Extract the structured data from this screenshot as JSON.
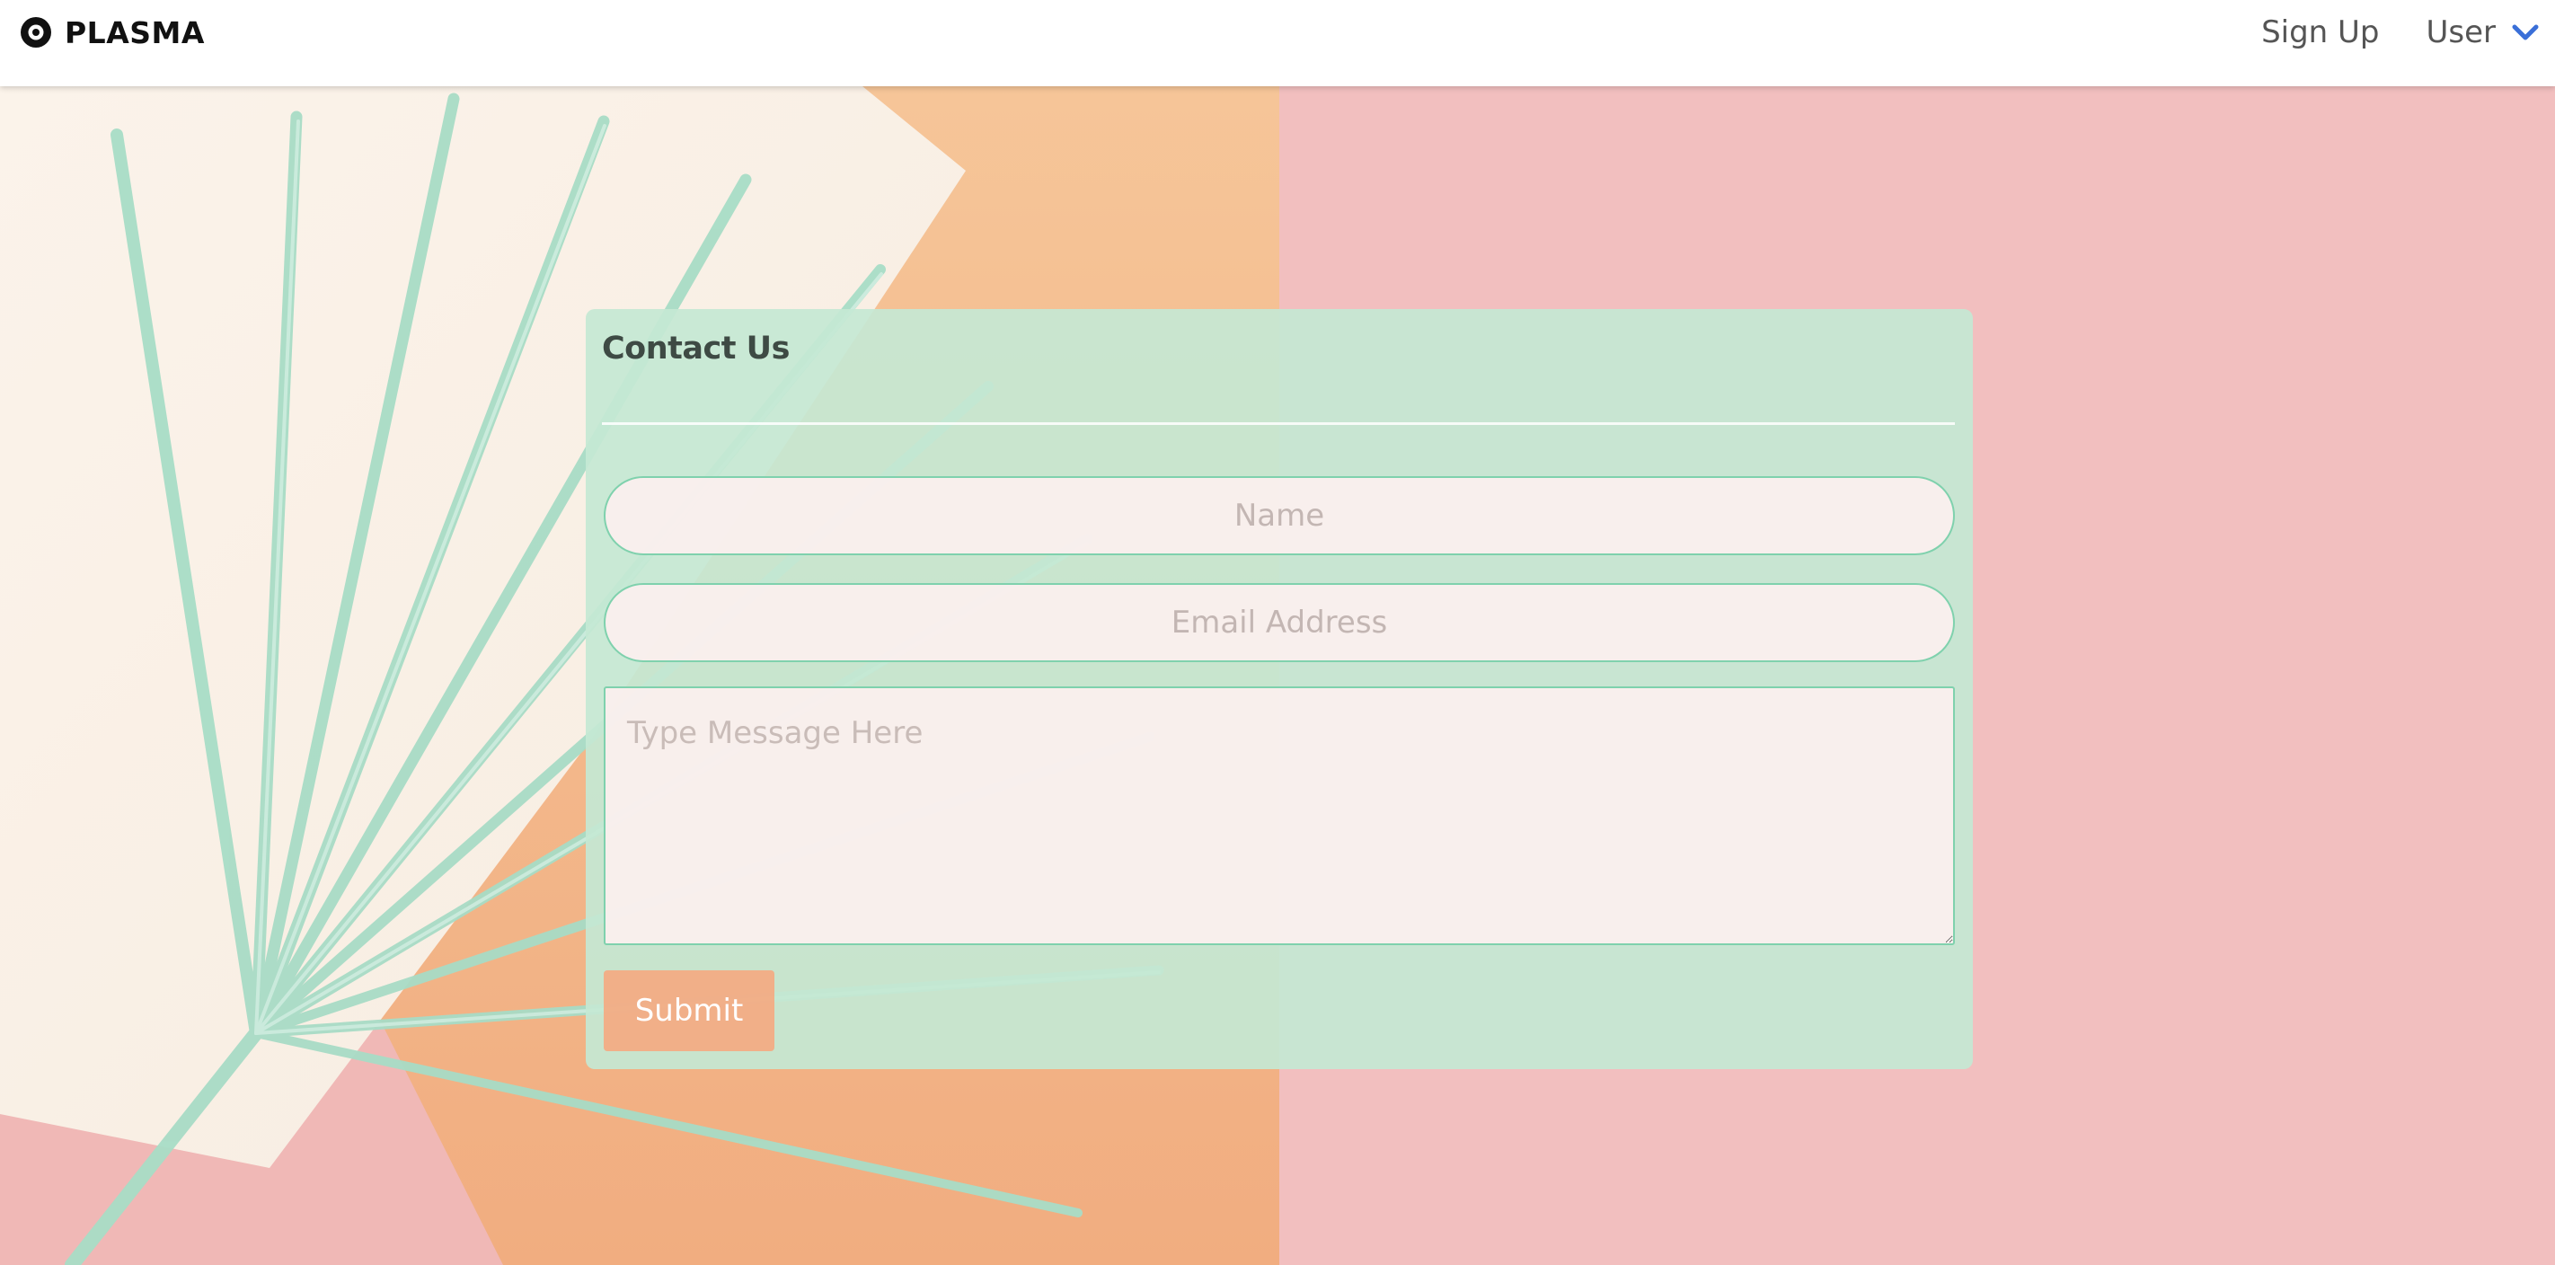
{
  "navbar": {
    "brand": "PLASMA",
    "brand_icon": "vinyl-record-icon",
    "links": {
      "sign_up": "Sign Up",
      "user": "User"
    },
    "user_menu_icon": "chevron-down-icon",
    "accent_color": "#3a6fd8"
  },
  "contact_form": {
    "title": "Contact Us",
    "name_placeholder": "Name",
    "email_placeholder": "Email Address",
    "message_placeholder": "Type Message Here",
    "submit_label": "Submit"
  },
  "colors": {
    "page_pink": "#f2bfbf",
    "peach": "#f3ba8d",
    "card_mint": "#c4e8d4",
    "input_border": "#7fd1ad",
    "submit_bg": "#f4aa82"
  }
}
